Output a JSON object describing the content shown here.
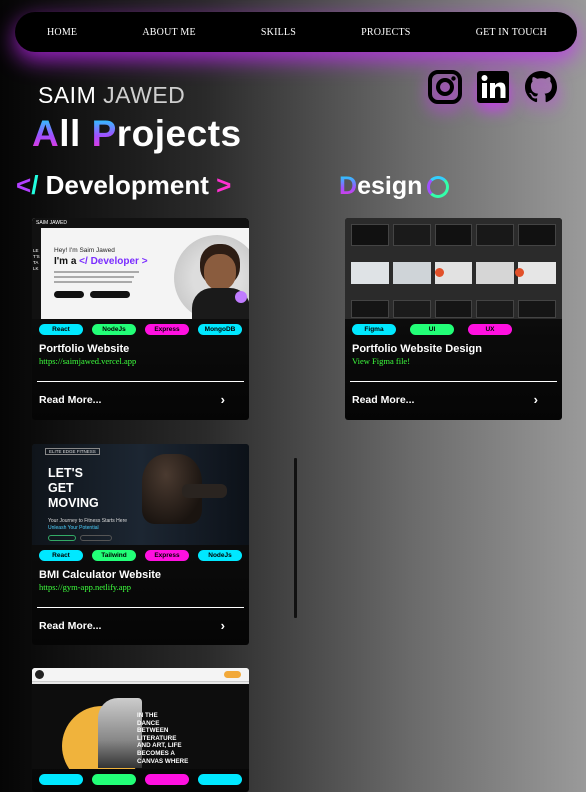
{
  "nav": {
    "items": [
      "HOME",
      "ABOUT ME",
      "SKILLS",
      "PROJECTS",
      "GET IN TOUCH"
    ]
  },
  "social": {
    "icons": [
      "instagram-icon",
      "linkedin-icon",
      "github-icon"
    ]
  },
  "header": {
    "first_name": "SAIM",
    "last_name": "JAWED",
    "title_first_letter": "A",
    "title_mid": "ll ",
    "title_p": "P",
    "title_rest": "rojects"
  },
  "sections": {
    "dev_open": "<",
    "dev_slash": "/",
    "dev_label": " Development ",
    "dev_close": ">",
    "design_first": "D",
    "design_rest": "esign"
  },
  "dev_cards": [
    {
      "tags": [
        "React",
        "NodeJs",
        "Express",
        "MongoDB"
      ],
      "title": "Portfolio Website",
      "link": "https://saimjawed.vercel.app",
      "read_more": "Read More...",
      "thumb": {
        "brand": "SAIM JAWED",
        "greeting": "Hey! I'm Saim Jawed",
        "role_prefix": "I'm a ",
        "role": "</ Developer >",
        "side_text": "LET'S TALK"
      }
    },
    {
      "tags": [
        "React",
        "Tailwind",
        "Express",
        "NodeJs"
      ],
      "title": "BMI Calculator Website",
      "link": "https://gym-app.netlify.app",
      "read_more": "Read More...",
      "thumb": {
        "badge": "ELITE EDGE FITNESS",
        "headline": [
          "LET'S",
          "GET",
          "MOVING"
        ],
        "sub": "Your Journey to Fitness Starts Here",
        "sub2": "Unleash Your Potential"
      }
    },
    {
      "tags": [
        "",
        "",
        "",
        ""
      ],
      "thumb": {
        "quote": [
          "IN THE",
          "DANCE",
          "BETWEEN",
          "LITERATURE",
          "AND ART, LIFE",
          "BECOMES A",
          "CANVAS WHERE"
        ]
      }
    }
  ],
  "design_cards": [
    {
      "tags": [
        "Figma",
        "UI",
        "UX"
      ],
      "title": "Portfolio Website Design",
      "link": "View Figma file!",
      "read_more": "Read More..."
    }
  ]
}
